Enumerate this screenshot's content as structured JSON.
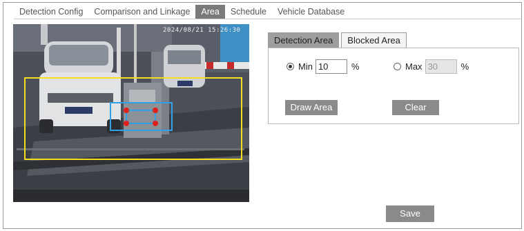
{
  "tabs": [
    {
      "label": "Detection Config",
      "active": false
    },
    {
      "label": "Comparison and Linkage",
      "active": false
    },
    {
      "label": "Area",
      "active": true
    },
    {
      "label": "Schedule",
      "active": false
    },
    {
      "label": "Vehicle Database",
      "active": false
    }
  ],
  "preview": {
    "osd_text": "2024/08/21 15:26:30"
  },
  "area_tabs": {
    "detection": "Detection Area",
    "blocked": "Blocked Area"
  },
  "sensitivity": {
    "min_label": "Min",
    "min_value": "10",
    "min_unit": "%",
    "min_checked": true,
    "max_label": "Max",
    "max_value": "30",
    "max_unit": "%",
    "max_checked": false
  },
  "buttons": {
    "draw_area": "Draw Area",
    "clear": "Clear",
    "save": "Save"
  },
  "colors": {
    "detection_box": "#f4de1f",
    "blocked_box": "#2fa1e6",
    "handle": "#e0201c",
    "active_tab_bg": "#7a7a7a",
    "button_bg": "#8a8a8a"
  }
}
